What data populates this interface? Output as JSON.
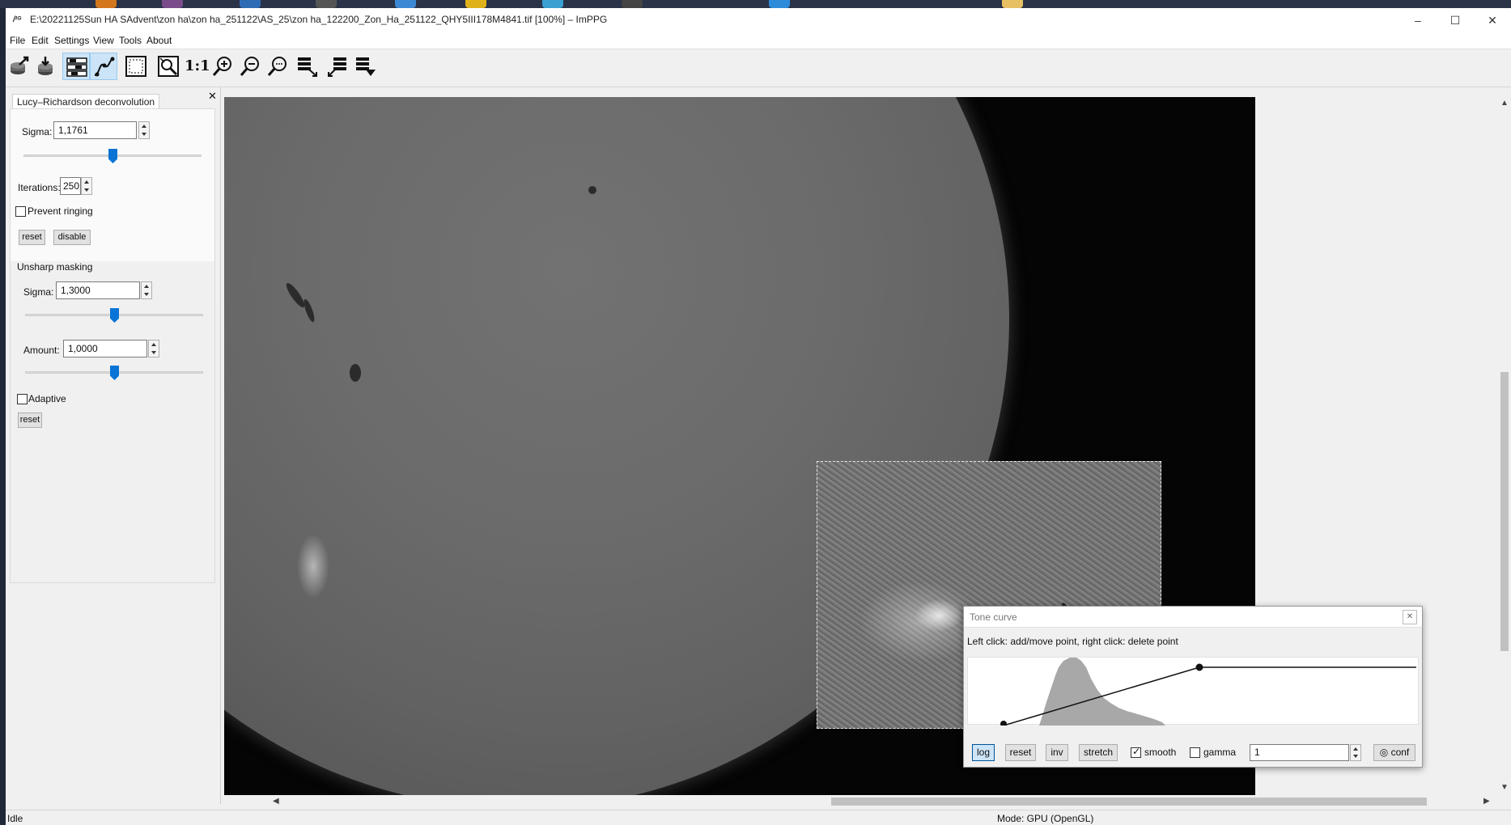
{
  "window": {
    "title": "E:\\20221125Sun HA SAdvent\\zon ha\\zon ha_251122\\AS_25\\zon ha_122200_Zon_Ha_251122_QHY5III178M4841.tif [100%] – ImPPG",
    "app_icon_text": "/ᴵᴳ"
  },
  "menu": [
    "File",
    "Edit",
    "Settings",
    "View",
    "Tools",
    "About"
  ],
  "toolbar": {
    "zoom_1to1_label": "1:1",
    "buttons": [
      "open-image-icon",
      "save-image-icon",
      "processing-panel-icon",
      "tone-curve-icon",
      "select-all-icon",
      "select-and-fit-icon",
      "zoom-actual-size-icon",
      "zoom-in-icon",
      "zoom-out-icon",
      "fit-in-window-icon",
      "batch-processing-icon",
      "alignment-icon",
      "more-tools-icon"
    ]
  },
  "lucy_richardson": {
    "tab_label": "Lucy–Richardson deconvolution",
    "sigma_label": "Sigma:",
    "sigma_value": "1,1761",
    "sigma_slider_fraction": 0.5,
    "iterations_label": "Iterations:",
    "iterations_value": "250",
    "prevent_ringing_label": "Prevent ringing",
    "prevent_ringing_checked": false,
    "reset_label": "reset",
    "disable_label": "disable"
  },
  "unsharp_masking": {
    "group_label": "Unsharp masking",
    "sigma_label": "Sigma:",
    "sigma_value": "1,3000",
    "sigma_slider_fraction": 0.5,
    "amount_label": "Amount:",
    "amount_value": "1,0000",
    "amount_slider_fraction": 0.5,
    "adaptive_label": "Adaptive",
    "adaptive_checked": false,
    "reset_label": "reset"
  },
  "tone_curve": {
    "title": "Tone curve",
    "instructions": "Left click: add/move point, right click: delete point",
    "log_label": "log",
    "log_pressed": true,
    "reset_label": "reset",
    "inv_label": "inv",
    "stretch_label": "stretch",
    "smooth_label": "smooth",
    "smooth_checked": true,
    "gamma_label": "gamma",
    "gamma_checked": false,
    "gamma_value": "1",
    "conf_label": "conf"
  },
  "status": {
    "left": "Idle",
    "mode": "Mode: GPU (OpenGL)"
  },
  "colors": {
    "accent": "#0a74d6",
    "active_tool": "#cce4f7",
    "background": "#f0f0f0"
  }
}
